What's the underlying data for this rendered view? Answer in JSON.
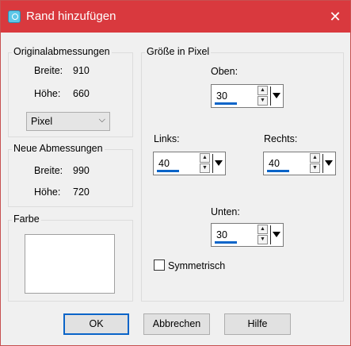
{
  "window": {
    "title": "Rand hinzufügen",
    "icon": "camera-icon",
    "close_glyph": "✕",
    "accent": "#d9393e"
  },
  "original": {
    "heading": "Originalabmessungen",
    "width_label": "Breite:",
    "width_value": "910",
    "height_label": "Höhe:",
    "height_value": "660",
    "unit_selected": "Pixel",
    "unit_chevron": "⌵"
  },
  "new_dims": {
    "heading": "Neue Abmessungen",
    "width_label": "Breite:",
    "width_value": "990",
    "height_label": "Höhe:",
    "height_value": "720"
  },
  "color": {
    "heading": "Farbe",
    "swatch": "#ffffff"
  },
  "size": {
    "heading": "Größe in Pixel",
    "top_label": "Oben:",
    "top_value": "30",
    "left_label": "Links:",
    "left_value": "40",
    "right_label": "Rechts:",
    "right_value": "40",
    "bottom_label": "Unten:",
    "bottom_value": "30",
    "symmetric_label": "Symmetrisch",
    "symmetric_checked": false
  },
  "spin_up_glyph": "▲",
  "spin_down_glyph": "▼",
  "buttons": {
    "ok": "OK",
    "cancel": "Abbrechen",
    "help": "Hilfe"
  }
}
